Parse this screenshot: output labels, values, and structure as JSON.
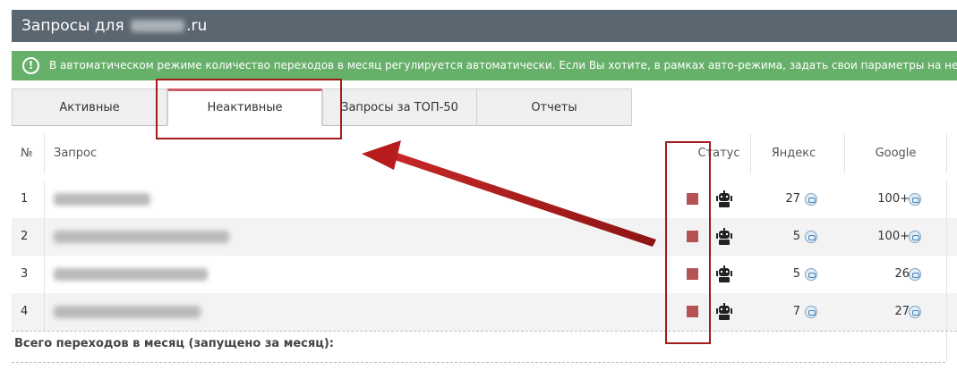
{
  "header": {
    "title_prefix": "Запросы для",
    "title_suffix": ".ru"
  },
  "notice": {
    "icon": "!",
    "text": "В автоматическом режиме количество переходов в месяц регулируется автоматически. Если Вы хотите, в рамках авто-режима, задать свои параметры на неко"
  },
  "tabs": [
    {
      "label": "Активные",
      "active": false
    },
    {
      "label": "Неактивные",
      "active": true
    },
    {
      "label": "Запросы за ТОП-50",
      "active": false
    },
    {
      "label": "Отчеты",
      "active": false
    }
  ],
  "table": {
    "columns": {
      "num": "№",
      "query": "Запрос",
      "status": "Статус",
      "yandex": "Яндекс",
      "google": "Google"
    },
    "rows": [
      {
        "num": "1",
        "yandex": "27",
        "google": "100+"
      },
      {
        "num": "2",
        "yandex": "5",
        "google": "100+"
      },
      {
        "num": "3",
        "yandex": "5",
        "google": "26"
      },
      {
        "num": "4",
        "yandex": "7",
        "google": "27"
      }
    ],
    "total_label": "Всего переходов в месяц (запущено за месяц):"
  },
  "colors": {
    "header_bg": "#5a6670",
    "notice_bg": "#67b06a",
    "active_tab_accent": "#cd5c67",
    "status_stopped": "#b55253",
    "annotation": "#a31a1a"
  }
}
